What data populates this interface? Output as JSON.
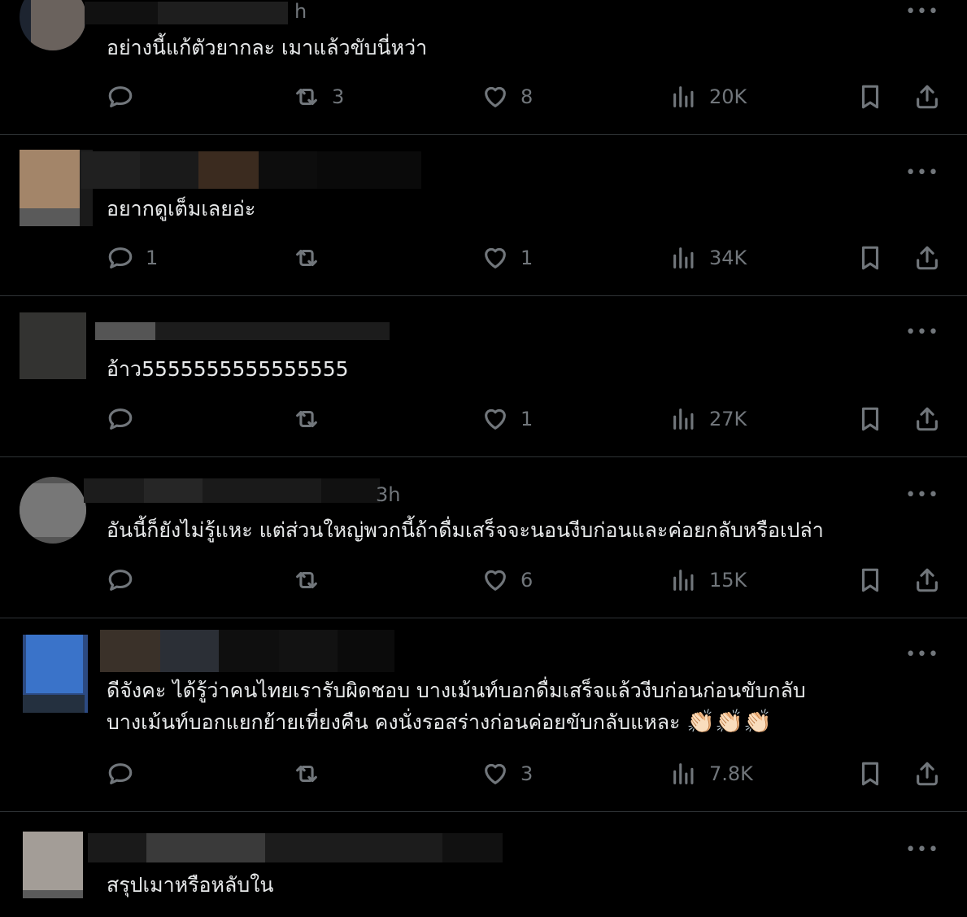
{
  "replies": [
    {
      "time": "h",
      "text": [
        "อย่างนี้แก้ตัวยากละ เมาแล้วขับนี่หว่า"
      ],
      "replies": "",
      "reposts": "3",
      "likes": "8",
      "views": "20K"
    },
    {
      "time": "",
      "text": [
        "อยากดูเต็มเลยอ่ะ"
      ],
      "replies": "1",
      "reposts": "",
      "likes": "1",
      "views": "34K"
    },
    {
      "time": "",
      "text": [
        "อ้าว5555555555555555"
      ],
      "replies": "",
      "reposts": "",
      "likes": "1",
      "views": "27K"
    },
    {
      "time": "3h",
      "text": [
        "อันนี้ก็ยังไม่รู้แหะ แต่ส่วนใหญ่พวกนี้ถ้าดื่มเสร็จจะนอนงีบก่อนและค่อยกลับหรือเปล่า"
      ],
      "replies": "",
      "reposts": "",
      "likes": "6",
      "views": "15K"
    },
    {
      "time": "",
      "text": [
        "ดีจังคะ ได้รู้ว่าคนไทยเรารับผิดชอบ บางเม้นท์บอกดื่มเสร็จแล้วงีบก่อนก่อนขับกลับ",
        "บางเม้นท์บอกแยกย้ายเที่ยงคืน คงนั่งรอสร่างก่อนค่อยขับกลับแหละ "
      ],
      "emoji": "👏🏻👏🏻👏🏻",
      "replies": "",
      "reposts": "",
      "likes": "3",
      "views": "7.8K"
    },
    {
      "time": "",
      "text": [
        "สรุปเมาหรือหลับใน"
      ]
    }
  ],
  "icons": {
    "reply": "speech-bubble-icon",
    "repost": "repost-arrows-icon",
    "like": "heart-icon",
    "views": "bar-chart-icon",
    "bookmark": "bookmark-icon",
    "share": "share-upload-icon",
    "more": "more-dots-icon"
  },
  "more_label": "•••",
  "colors": {
    "background": "#000000",
    "text": "#e7e9ea",
    "muted": "#71767b",
    "divider": "#2f3336"
  }
}
